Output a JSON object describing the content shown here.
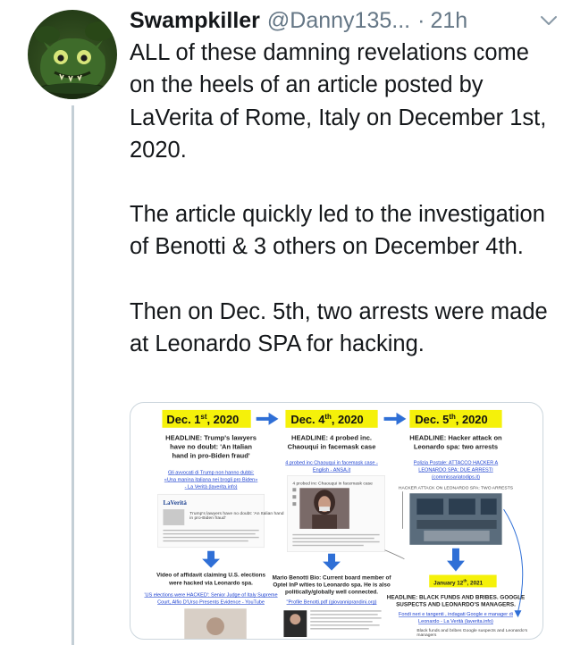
{
  "tweet": {
    "display_name": "Swampkiller",
    "handle": "@Danny135...",
    "separator": "·",
    "time": "21h",
    "paragraphs": [
      "ALL of these damning revelations come on the heels of an article posted by LaVerita of Rome, Italy on December 1st, 2020.",
      "The article quickly led to the investigation of Benotti & 3 others on December 4th.",
      "Then on Dec. 5th, two arrests were made at Leonardo SPA for hacking."
    ]
  },
  "media": {
    "col1": {
      "date_main": "Dec. 1",
      "date_sup": "st",
      "date_year": ", 2020",
      "headline": [
        "HEADLINE: Trump's lawyers",
        "have no doubt: 'An Italian",
        "hand in pro-Biden fraud'"
      ],
      "links": [
        "Gli avvocati di Trump non hanno dubbi:",
        "«Una manina italiana nei brogli pro Biden»",
        "- La Verità (laverita.info)"
      ],
      "logo": "LaVerità",
      "article_title": [
        "Trump's lawyers have no doubt: 'An Italian hand",
        "in pro-Biden fraud'"
      ],
      "caption": [
        "Video of affidavit claiming U.S. elections",
        "were hacked via Leonardo spa."
      ],
      "footer_links": [
        "'US elections were HACKED': Senior Judge of Italy Supreme",
        "Court, Alfio D'Urso Presents Evidence - YouTube"
      ]
    },
    "col2": {
      "date_main": "Dec. 4",
      "date_sup": "th",
      "date_year": ", 2020",
      "headline": [
        "HEADLINE: 4 probed inc.",
        "Chaouqui in facemask case"
      ],
      "links": [
        "4 probed inc Chaouqui in facemask case -",
        "English - ANSA.it"
      ],
      "inner_title": "4 probed inc Chaouqui in facemask case",
      "caption": [
        "Mario Benotti Bio: Current board member of",
        "Optel InP w/ties to Leonardo spa. He is also",
        "politically/globally well connected."
      ],
      "footer_links": [
        "\"Profile Benotti.pdf (giovanniprandini.org)"
      ]
    },
    "col3": {
      "date_main": "Dec. 5",
      "date_sup": "th",
      "date_year": ", 2020",
      "headline": [
        "HEADLINE: Hacker attack on",
        "Leonardo spa: two arrests"
      ],
      "links": [
        "Polizia Postale: ATTACCO HACKER A",
        "LEONARDO SPA: DUE ARRESTI",
        "(commissariatodips.it)"
      ],
      "inner_title": "HACKER ATTACK ON LEONARDO SPA: TWO ARRESTS",
      "date2_main": "January 12",
      "date2_sup": "th",
      "date2_year": ", 2021",
      "headline2": [
        "HEADLINE: BLACK FUNDS AND BRIBES. GOOGLE",
        "SUSPECTS AND LEONARDO'S MANAGERS."
      ],
      "links2": [
        "Fondi neri e tangenti , indagati Google e manager di",
        "Leonardo - La Verità (laverita.info)"
      ],
      "note": [
        "Black funds and bribes Google suspects and Leonardo's",
        "managers"
      ]
    },
    "colors": {
      "highlight": "#f5f10a",
      "arrow": "#2f6fd6",
      "link": "#1a3fd0"
    }
  }
}
